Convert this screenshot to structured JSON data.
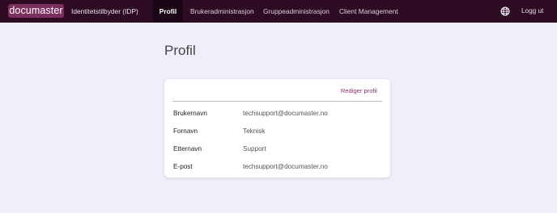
{
  "header": {
    "logo_text": "documaster",
    "app_title": "Identitetstilbyder (IDP)",
    "nav": [
      {
        "label": "Profil",
        "active": true
      },
      {
        "label": "Brukeradministrasjon",
        "active": false
      },
      {
        "label": "Gruppeadministrasjon",
        "active": false
      },
      {
        "label": "Client Management",
        "active": false
      }
    ],
    "language_icon": "globe-icon",
    "logout_label": "Logg ut"
  },
  "page": {
    "title": "Profil"
  },
  "profile_card": {
    "edit_label": "Rediger profil",
    "fields": [
      {
        "label": "Brukernavn",
        "value": "techsupport@documaster.no"
      },
      {
        "label": "Fornavn",
        "value": "Teknisk"
      },
      {
        "label": "Etternavn",
        "value": "Support"
      },
      {
        "label": "E-post",
        "value": "techsupport@documaster.no"
      }
    ]
  },
  "colors": {
    "topbar": "#2c0b23",
    "logo_bg": "#7a2f5e",
    "active_nav_bg": "#1a0615",
    "page_bg": "#f0eff9",
    "accent_link": "#8a2f68"
  }
}
